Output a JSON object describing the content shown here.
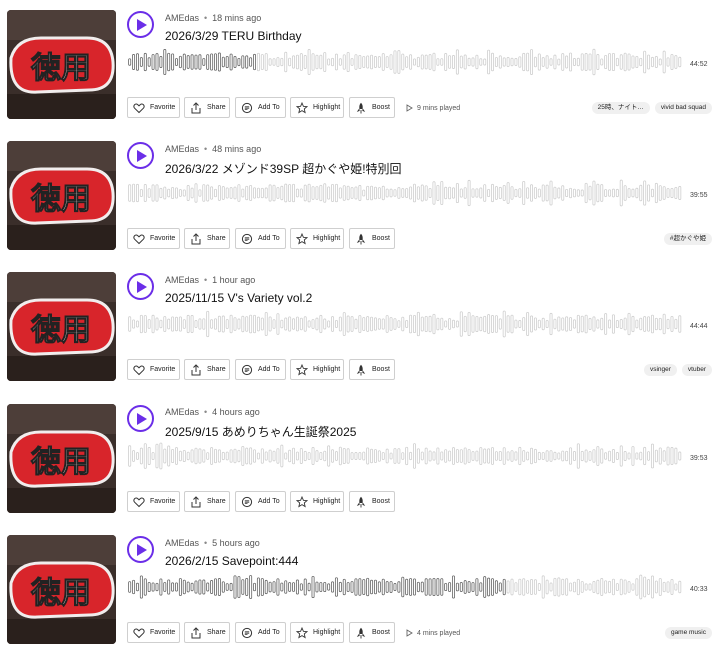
{
  "accent": "#6b2ee8",
  "buttons": {
    "favorite": "Favorite",
    "share": "Share",
    "add_to": "Add To",
    "highlight": "Highlight",
    "boost": "Boost"
  },
  "cover_text": "徳用",
  "tracks": [
    {
      "author": "AMEdas",
      "time_ago": "18 mins ago",
      "title": "2026/3/29 TERU Birthday",
      "duration": "44:52",
      "played": "9 mins played",
      "progress": 0.23,
      "tags": [
        "25時、ナイト…",
        "vivid bad squad"
      ]
    },
    {
      "author": "AMEdas",
      "time_ago": "48 mins ago",
      "title": "2026/3/22 メゾンド39SP 超かぐや姫!特別回",
      "duration": "39:55",
      "played": "",
      "progress": 0,
      "tags": [
        "#超かぐや姫"
      ]
    },
    {
      "author": "AMEdas",
      "time_ago": "1 hour ago",
      "title": "2025/11/15 V's Variety vol.2",
      "duration": "44:44",
      "played": "",
      "progress": 0,
      "tags": [
        "vsinger",
        "vtuber"
      ]
    },
    {
      "author": "AMEdas",
      "time_ago": "4 hours ago",
      "title": "2025/9/15 あめりちゃん生誕祭2025",
      "duration": "39:53",
      "played": "",
      "progress": 0,
      "tags": []
    },
    {
      "author": "AMEdas",
      "time_ago": "5 hours ago",
      "title": "2026/2/15 Savepoint:444",
      "duration": "40:33",
      "played": "4 mins played",
      "progress": 0.68,
      "tags": [
        "game music"
      ]
    }
  ]
}
